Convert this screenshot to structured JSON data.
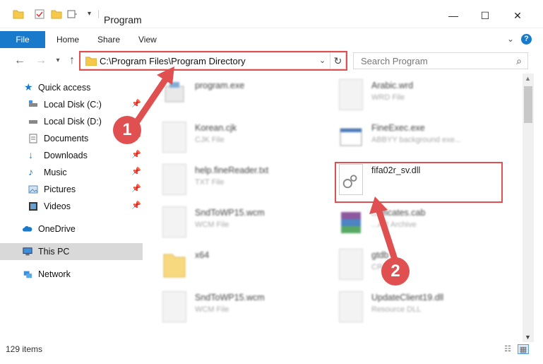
{
  "window": {
    "title": "Program",
    "minimize": "—",
    "maximize": "☐",
    "close": "✕"
  },
  "ribbon": {
    "tabs": [
      "File",
      "Home",
      "Share",
      "View"
    ],
    "help": "?"
  },
  "address": {
    "path": "C:\\Program Files\\Program Directory",
    "search_placeholder": "Search Program"
  },
  "sidebar": {
    "items": [
      {
        "label": "Quick access",
        "icon": "star-icon",
        "pinned": false
      },
      {
        "label": "Local Disk (C:)",
        "icon": "drive-icon",
        "pinned": true
      },
      {
        "label": "Local Disk (D:)",
        "icon": "drive-icon",
        "pinned": true
      },
      {
        "label": "Documents",
        "icon": "documents-icon",
        "pinned": true
      },
      {
        "label": "Downloads",
        "icon": "download-icon",
        "pinned": true
      },
      {
        "label": "Music",
        "icon": "music-icon",
        "pinned": true
      },
      {
        "label": "Pictures",
        "icon": "pictures-icon",
        "pinned": true
      },
      {
        "label": "Videos",
        "icon": "videos-icon",
        "pinned": true
      },
      {
        "label": "OneDrive",
        "icon": "cloud-icon",
        "pinned": false
      },
      {
        "label": "This PC",
        "icon": "pc-icon",
        "pinned": false,
        "selected": true
      },
      {
        "label": "Network",
        "icon": "network-icon",
        "pinned": false
      }
    ]
  },
  "files": {
    "left": [
      {
        "name": "program.exe",
        "type": ""
      },
      {
        "name": "Korean.cjk",
        "type": "CJK File"
      },
      {
        "name": "help.fineReader.txt",
        "type": "TXT File"
      },
      {
        "name": "SndToWP15.wcm",
        "type": "WCM File"
      },
      {
        "name": "x64",
        "type": ""
      },
      {
        "name": "SndToWP15.wcm",
        "type": "WCM File"
      }
    ],
    "right": [
      {
        "name": "Arabic.wrd",
        "type": "WRD File"
      },
      {
        "name": "FineExec.exe",
        "type": "ABBYY background exe..."
      },
      {
        "name": "fifa02r_sv.dll",
        "type": ""
      },
      {
        "name": "...tificates.cab",
        "type": "...AR Archive"
      },
      {
        "name": "gtdb",
        "type": "CR"
      },
      {
        "name": "UpdateClient19.dll",
        "type": "Resource DLL"
      }
    ]
  },
  "status": {
    "count": "129 items"
  },
  "callouts": [
    "1",
    "2"
  ],
  "colors": {
    "accent": "#1979ca",
    "highlight": "#e05050",
    "selected": "#d9d9d9"
  }
}
